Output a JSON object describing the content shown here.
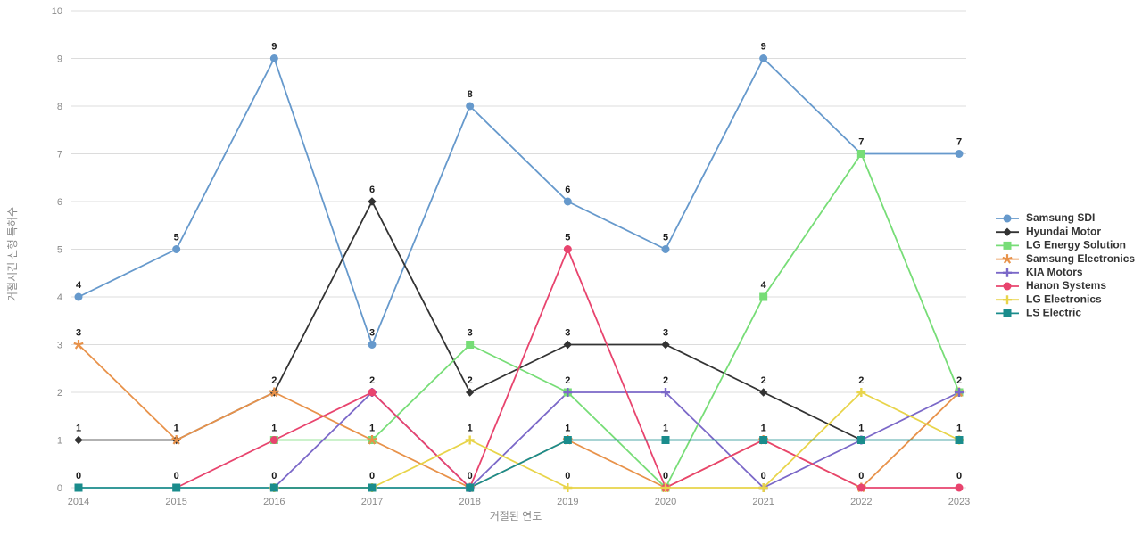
{
  "chart_data": {
    "type": "line",
    "title": "",
    "xlabel": "거절된 연도",
    "ylabel": "거절시긴 신행 특허수",
    "categories": [
      "2014",
      "2015",
      "2016",
      "2017",
      "2018",
      "2019",
      "2020",
      "2021",
      "2022",
      "2023"
    ],
    "ylim": [
      0,
      10
    ],
    "yticks": [
      "0",
      "1",
      "2",
      "3",
      "4",
      "5",
      "6",
      "7",
      "8",
      "9",
      "10"
    ],
    "grid": true,
    "legend_position": "right",
    "show_point_labels": true,
    "series": [
      {
        "name": "Samsung SDI",
        "color": "#6699CC",
        "marker": "circle",
        "values": [
          4,
          5,
          9,
          3,
          8,
          6,
          5,
          9,
          7,
          7
        ]
      },
      {
        "name": "Hyundai Motor",
        "color": "#333333",
        "marker": "diamond",
        "values": [
          1,
          1,
          2,
          6,
          2,
          3,
          3,
          2,
          1,
          null
        ]
      },
      {
        "name": "LG Energy Solution",
        "color": "#77DD77",
        "marker": "square",
        "values": [
          null,
          null,
          1,
          1,
          3,
          2,
          0,
          4,
          7,
          2
        ]
      },
      {
        "name": "Samsung Electronics",
        "color": "#E8924A",
        "marker": "star",
        "values": [
          3,
          1,
          2,
          1,
          0,
          1,
          0,
          1,
          0,
          2
        ]
      },
      {
        "name": "KIA Motors",
        "color": "#7B68C8",
        "marker": "plus",
        "values": [
          null,
          null,
          0,
          2,
          0,
          2,
          2,
          0,
          1,
          2
        ]
      },
      {
        "name": "Hanon Systems",
        "color": "#E8446E",
        "marker": "circle",
        "values": [
          null,
          0,
          1,
          2,
          0,
          5,
          0,
          1,
          0,
          0
        ]
      },
      {
        "name": "LG Electronics",
        "color": "#E8D44A",
        "marker": "plus",
        "values": [
          null,
          null,
          0,
          0,
          1,
          0,
          0,
          0,
          2,
          1
        ]
      },
      {
        "name": "LS Electric",
        "color": "#1A8C8C",
        "marker": "square",
        "values": [
          0,
          0,
          0,
          0,
          0,
          1,
          1,
          1,
          1,
          1
        ]
      }
    ]
  },
  "legend": {
    "entries": [
      "Samsung SDI",
      "Hyundai Motor",
      "LG Energy Solution",
      "Samsung Electronics",
      "KIA Motors",
      "Hanon Systems",
      "LG Electronics",
      "LS Electric"
    ]
  }
}
